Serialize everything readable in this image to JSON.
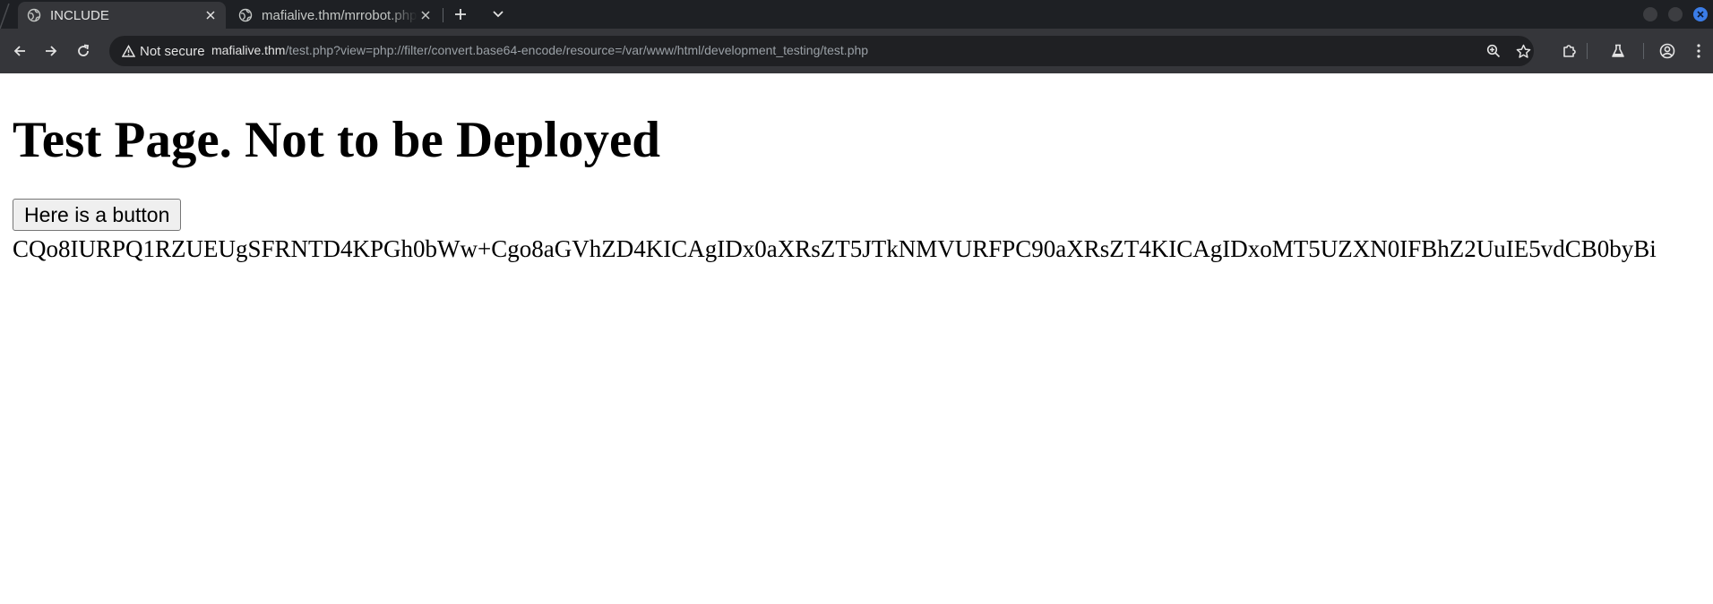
{
  "browser": {
    "tabs": [
      {
        "title": "INCLUDE",
        "icon": "globe-icon",
        "active": true
      },
      {
        "title": "mafialive.thm/mrrobot.php",
        "icon": "globe-icon",
        "active": false
      }
    ],
    "address_bar": {
      "security_label": "Not secure",
      "url_host": "mafialive.thm",
      "url_rest": "/test.php?view=php://filter/convert.base64-encode/resource=/var/www/html/development_testing/test.php"
    },
    "icons": {
      "back": "back-arrow-icon",
      "forward": "forward-arrow-icon",
      "reload": "reload-icon",
      "zoom": "zoom-icon",
      "bookmark": "star-icon",
      "extensions": "puzzle-icon",
      "labs": "flask-icon",
      "profile": "profile-icon",
      "menu": "kebab-menu-icon"
    },
    "colors": {
      "tabstrip": "#1e2024",
      "toolbar": "#35363a",
      "omnibox": "#1f2023",
      "window_close": "#3b7de8"
    }
  },
  "page": {
    "heading": "Test Page. Not to be Deployed",
    "button_label": "Here is a button",
    "encoded_output": "CQo8IURPQ1RZUEUgSFRNTD4KPGh0bWw+Cgo8aGVhZD4KICAgIDx0aXRsZT5JTkNMVURFPC90aXRsZT4KICAgIDxoMT5UZXN0IFBhZ2UuIE5vdCB0byBi"
  }
}
